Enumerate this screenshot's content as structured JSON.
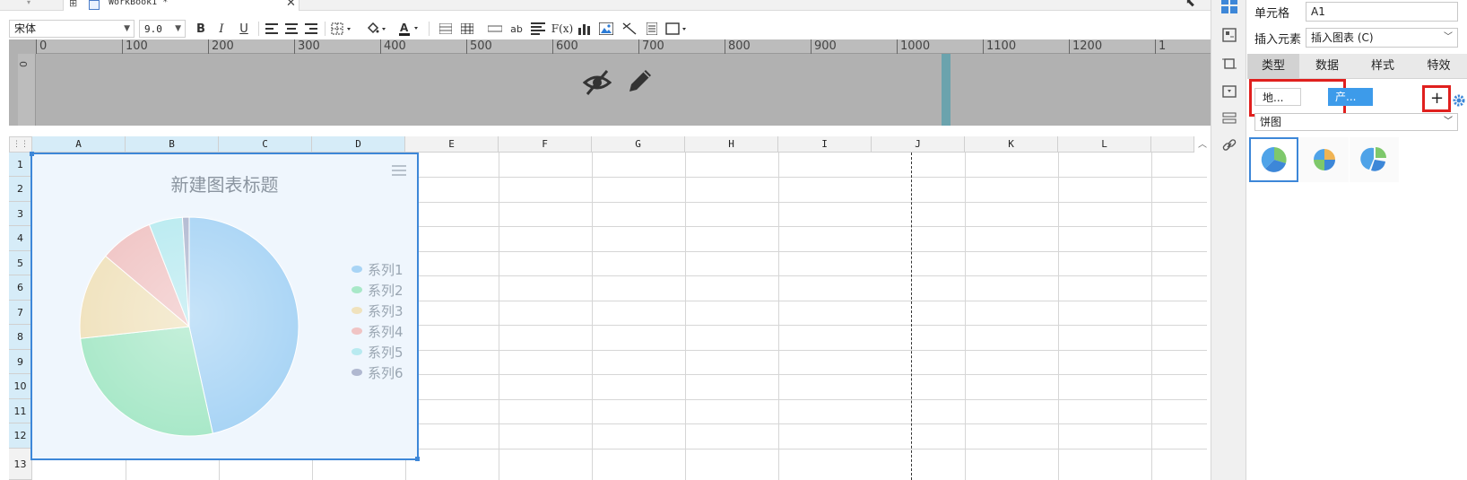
{
  "tabs": {
    "workbook_label": "WorkBook1 *",
    "close_glyph": "✕"
  },
  "toolbar": {
    "font_family": "宋体",
    "font_size": "9.0",
    "bold": "B",
    "italic": "I",
    "underline": "U",
    "wrap_label": "ab",
    "formula_label": "F(x)"
  },
  "ruler": {
    "ticks": [
      "0",
      "100",
      "200",
      "300",
      "400",
      "500",
      "600",
      "700",
      "800",
      "900",
      "1000",
      "1100",
      "1200",
      "1"
    ],
    "left_zero": "0"
  },
  "grid": {
    "columns": [
      "A",
      "B",
      "C",
      "D",
      "E",
      "F",
      "G",
      "H",
      "I",
      "J",
      "K",
      "L"
    ],
    "rows": [
      "1",
      "2",
      "3",
      "4",
      "5",
      "6",
      "7",
      "8",
      "9",
      "10",
      "11",
      "12",
      "13"
    ],
    "selected_columns": [
      "A",
      "B",
      "C",
      "D"
    ],
    "selected_rows": [
      "1",
      "2",
      "3",
      "4",
      "5",
      "6",
      "7",
      "8",
      "9",
      "10",
      "11",
      "12"
    ]
  },
  "chart": {
    "title": "新建图表标题"
  },
  "chart_data": {
    "type": "pie",
    "title": "新建图表标题",
    "categories": [
      "系列1",
      "系列2",
      "系列3",
      "系列4",
      "系列5",
      "系列6"
    ],
    "values": [
      47,
      27,
      13,
      8,
      5,
      1
    ],
    "colors": [
      "#a8d4f5",
      "#a8e8c8",
      "#f0e2bd",
      "#f0c4c4",
      "#b8eaf0",
      "#b0b8d0"
    ],
    "legend_position": "right"
  },
  "panel": {
    "cell_label": "单元格",
    "cell_value": "A1",
    "insert_label": "插入元素",
    "insert_value": "插入图表 (C)",
    "tabs": [
      "类型",
      "数据",
      "样式",
      "特效"
    ],
    "active_tab": "类型",
    "subtype_1": "地...",
    "subtype_2": "产...",
    "add_glyph": "+",
    "chart_type_value": "饼图"
  }
}
